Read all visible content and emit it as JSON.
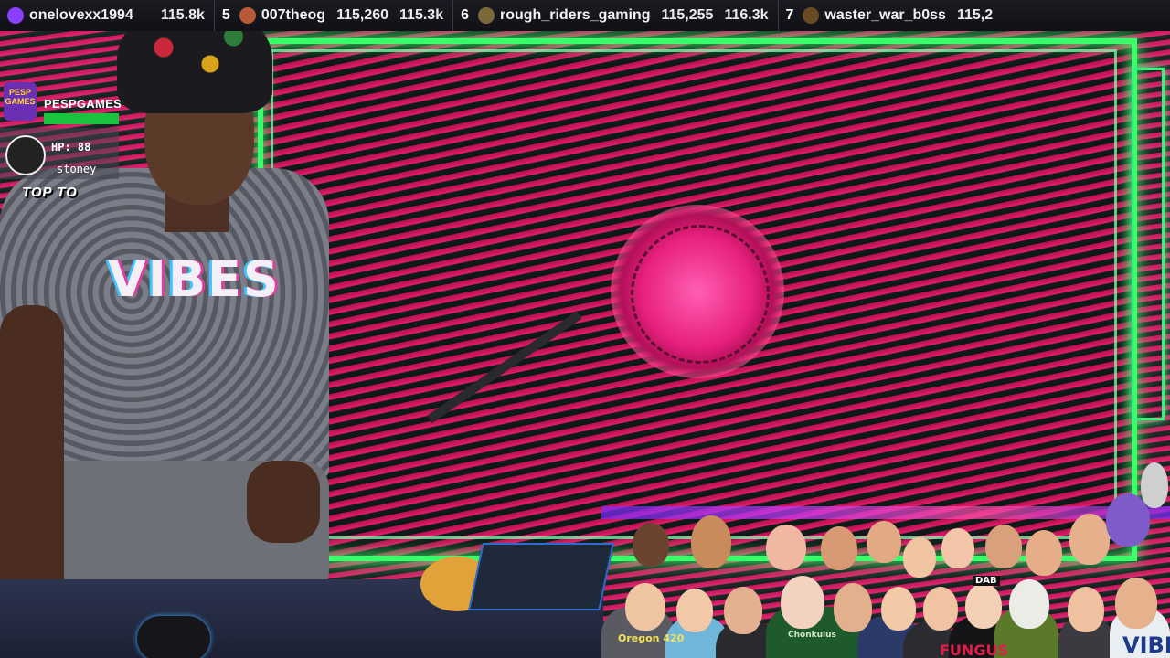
{
  "ticker": [
    {
      "rank": "",
      "name": "onelovexx1994",
      "score": "",
      "k": "115.8k",
      "avatar_color": "#8a3ffc"
    },
    {
      "rank": "5",
      "name": "007theog",
      "score": "115,260",
      "k": "115.3k",
      "avatar_color": "#b85a3a"
    },
    {
      "rank": "6",
      "name": "rough_riders_gaming",
      "score": "115,255",
      "k": "116.3k",
      "avatar_color": "#7a6a3a"
    },
    {
      "rank": "7",
      "name": "waster_war_b0ss",
      "score": "115,2",
      "k": "",
      "avatar_color": "#6a4a22"
    }
  ],
  "widget": {
    "logo_line1": "PESP",
    "logo_line2": "GAMES",
    "name": "PESPGAMES",
    "hp_label": "HP: 88",
    "user": "stoney",
    "title": "TOP TO"
  },
  "shirt_text": "VIBES",
  "crowd": {
    "shirt_oregon": "Oregon 420",
    "shirt_chonkulus": "Chonkulus",
    "shirt_vibe": "VIBE",
    "cap": "DAB",
    "hoodie_logo": "FUNGUS"
  },
  "colors": {
    "frame_green": "#39ff6a",
    "stripe_pink": "#e0266f",
    "stripe_dark": "#14201d",
    "hp_bar": "#19c43c"
  }
}
